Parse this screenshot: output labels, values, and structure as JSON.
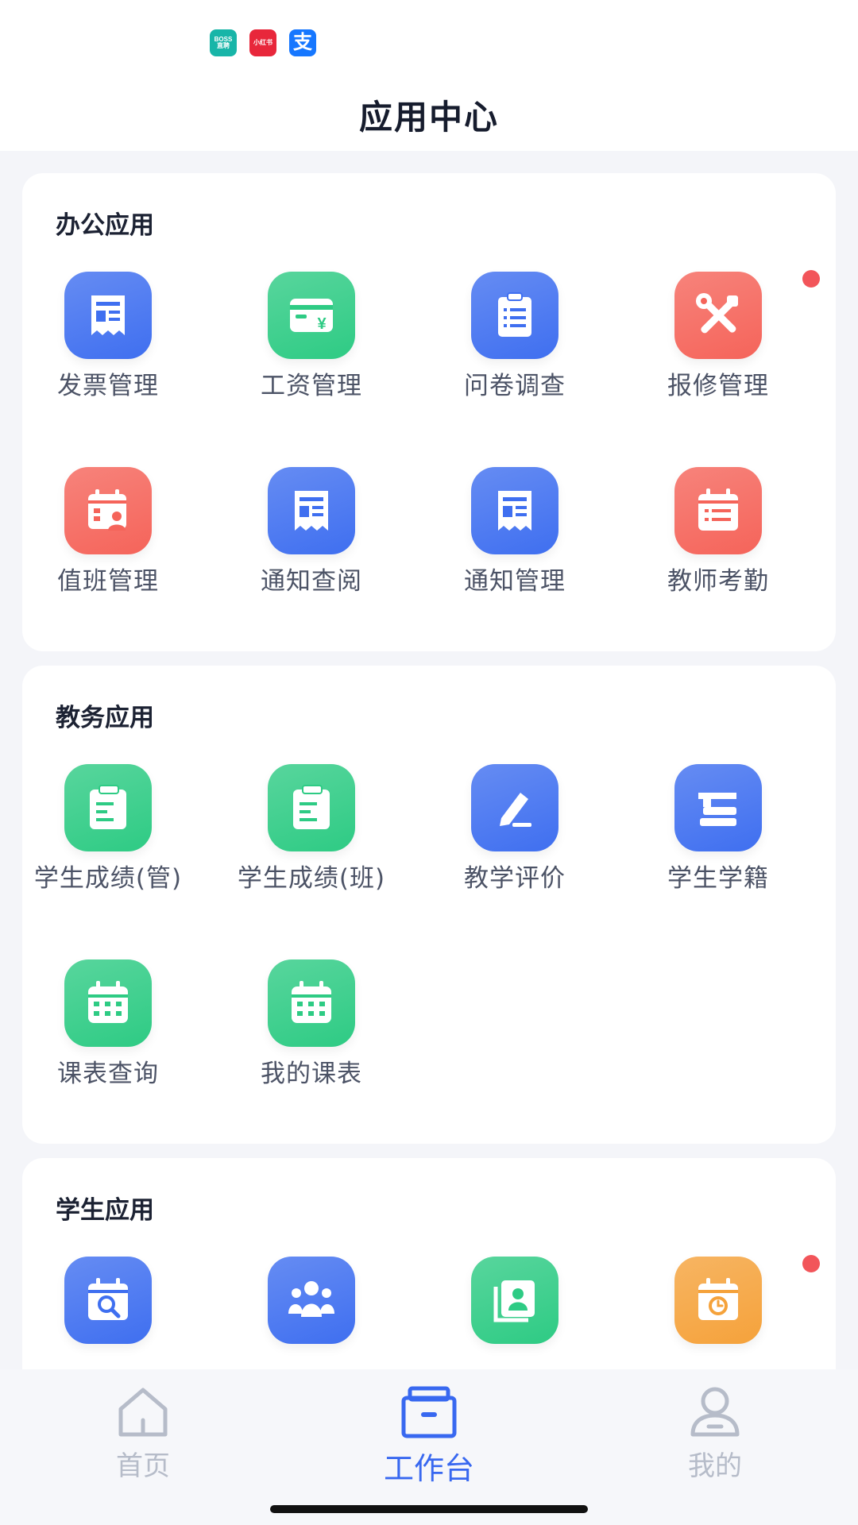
{
  "status_bar": {
    "apps": [
      {
        "name": "BOSS直聘",
        "line1": "BOSS",
        "line2": "直聘",
        "color": "#18b5a8"
      },
      {
        "name": "小红书",
        "text": "小红书",
        "color": "#e8273b"
      },
      {
        "name": "支付宝",
        "text": "支",
        "color": "#1677ff"
      }
    ]
  },
  "header": {
    "title": "应用中心"
  },
  "sections": [
    {
      "title": "办公应用",
      "apps": [
        {
          "label": "发票管理",
          "icon": "invoice-icon",
          "color": "#3f6ff0"
        },
        {
          "label": "工资管理",
          "icon": "salary-card-icon",
          "color": "#2ecb84"
        },
        {
          "label": "问卷调查",
          "icon": "survey-clipboard-icon",
          "color": "#3f6ff0"
        },
        {
          "label": "报修管理",
          "icon": "repair-tools-icon",
          "color": "#f5645a",
          "badge": true
        },
        {
          "label": "值班管理",
          "icon": "duty-calendar-person-icon",
          "color": "#f5645a"
        },
        {
          "label": "通知查阅",
          "icon": "notice-receipt-icon",
          "color": "#3f6ff0"
        },
        {
          "label": "通知管理",
          "icon": "notice-receipt-icon",
          "color": "#3f6ff0"
        },
        {
          "label": "教师考勤",
          "icon": "attendance-calendar-icon",
          "color": "#f5645a"
        }
      ]
    },
    {
      "title": "教务应用",
      "apps": [
        {
          "label": "学生成绩(管)",
          "icon": "grade-clipboard-icon",
          "color": "#2ecb84"
        },
        {
          "label": "学生成绩(班)",
          "icon": "grade-clipboard-icon",
          "color": "#2ecb84"
        },
        {
          "label": "教学评价",
          "icon": "pencil-edit-icon",
          "color": "#3f6ff0"
        },
        {
          "label": "学生学籍",
          "icon": "graduation-books-icon",
          "color": "#3f6ff0"
        },
        {
          "label": "课表查询",
          "icon": "timetable-calendar-icon",
          "color": "#2ecb84"
        },
        {
          "label": "我的课表",
          "icon": "timetable-calendar-icon",
          "color": "#2ecb84"
        }
      ]
    },
    {
      "title": "学生应用",
      "apps": [
        {
          "label": "",
          "icon": "calendar-search-icon",
          "color": "#3f6ff0"
        },
        {
          "label": "",
          "icon": "group-people-icon",
          "color": "#3f6ff0"
        },
        {
          "label": "",
          "icon": "student-profile-icon",
          "color": "#2ecb84"
        },
        {
          "label": "",
          "icon": "calendar-clock-icon",
          "color": "#f5a23b",
          "badge": true
        }
      ]
    }
  ],
  "tabbar": {
    "items": [
      {
        "label": "首页",
        "icon": "home-icon",
        "active": false
      },
      {
        "label": "工作台",
        "icon": "workbench-box-icon",
        "active": true
      },
      {
        "label": "我的",
        "icon": "profile-person-icon",
        "active": false
      }
    ],
    "active_color": "#3868f0",
    "inactive_color": "#b6bcc9"
  }
}
